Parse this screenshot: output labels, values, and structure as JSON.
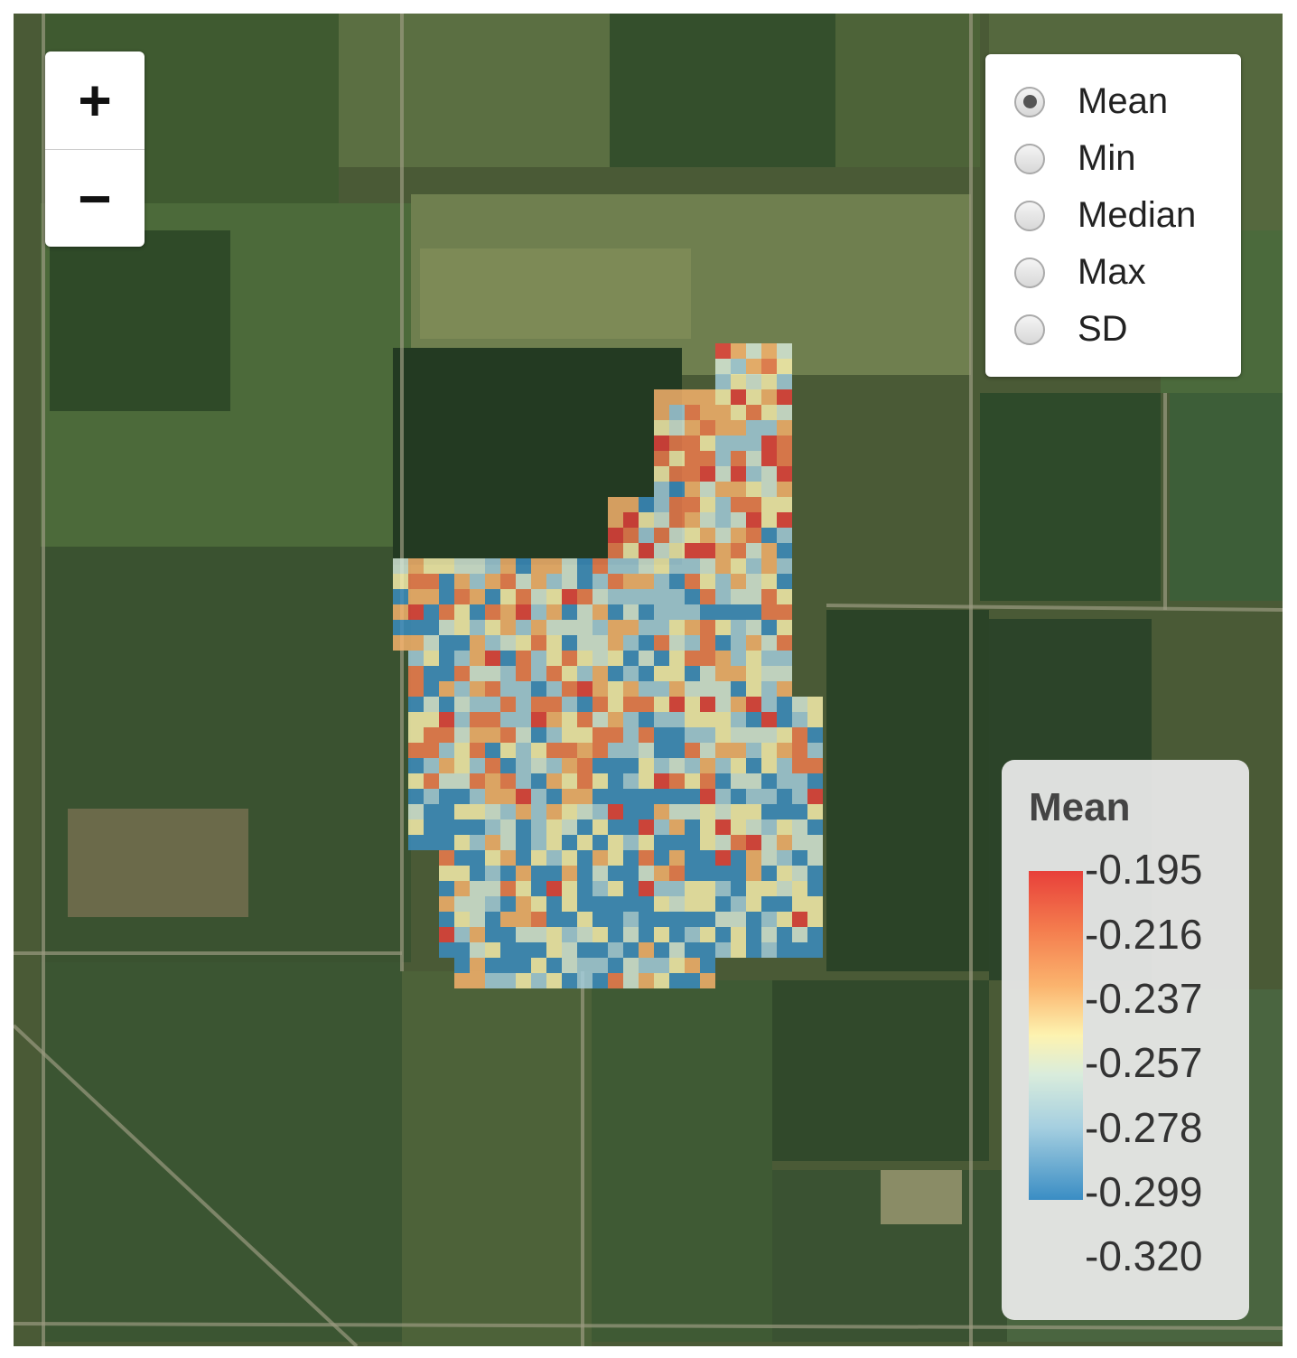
{
  "map": {
    "zoom_in_label": "+",
    "zoom_out_label": "−",
    "layers": [
      {
        "label": "Mean",
        "selected": true
      },
      {
        "label": "Min",
        "selected": false
      },
      {
        "label": "Median",
        "selected": false
      },
      {
        "label": "Max",
        "selected": false
      },
      {
        "label": "SD",
        "selected": false
      }
    ],
    "legend": {
      "title": "Mean",
      "ticks": [
        "-0.195",
        "-0.216",
        "-0.237",
        "-0.257",
        "-0.278",
        "-0.299",
        "-0.320"
      ],
      "colors": [
        "#e8403a",
        "#f47d4e",
        "#fbb46e",
        "#fdf3b0",
        "#d9ecdc",
        "#a5cfe0",
        "#3a8dc4"
      ]
    }
  }
}
